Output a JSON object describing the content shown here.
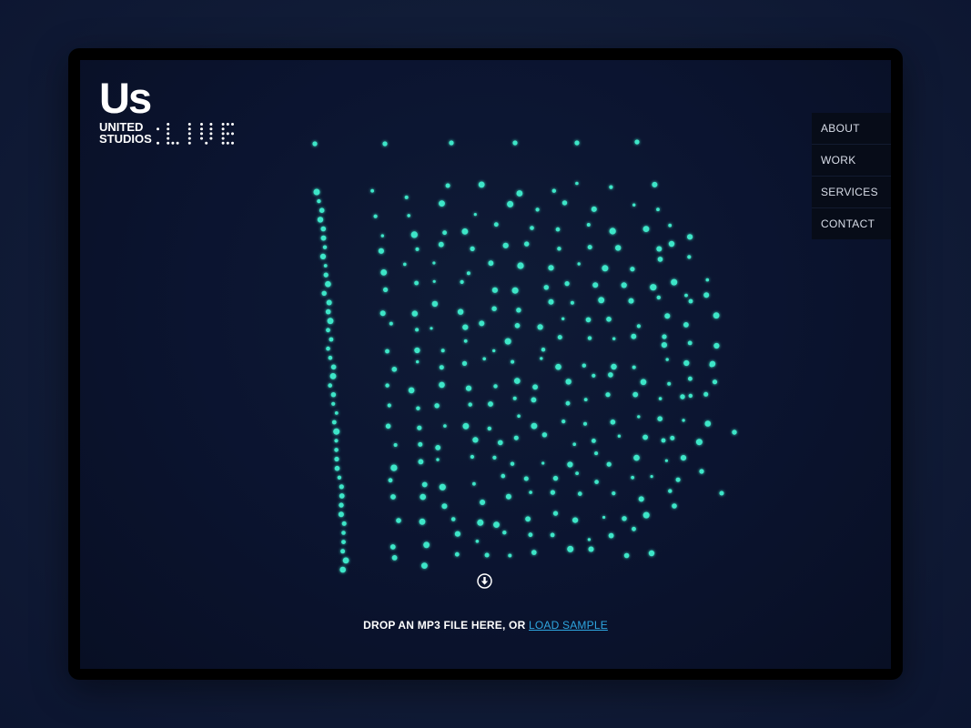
{
  "brand": {
    "mark": "Us",
    "line1": "UNITED",
    "line2": "STUDIOS",
    "suffix": "LIVE"
  },
  "nav": {
    "items": [
      {
        "label": "ABOUT"
      },
      {
        "label": "WORK"
      },
      {
        "label": "SERVICES"
      },
      {
        "label": "CONTACT"
      }
    ]
  },
  "visualizer": {
    "particle_color": "#3ee6c8",
    "glow_color": "#2fd3b7"
  },
  "dropzone": {
    "text": "DROP AN MP3 FILE HERE, OR",
    "link_label": "LOAD SAMPLE",
    "icon": "download-icon"
  },
  "colors": {
    "background": "#0b1430",
    "accent_link": "#2ea6e0",
    "nav_bg": "#070c18"
  }
}
